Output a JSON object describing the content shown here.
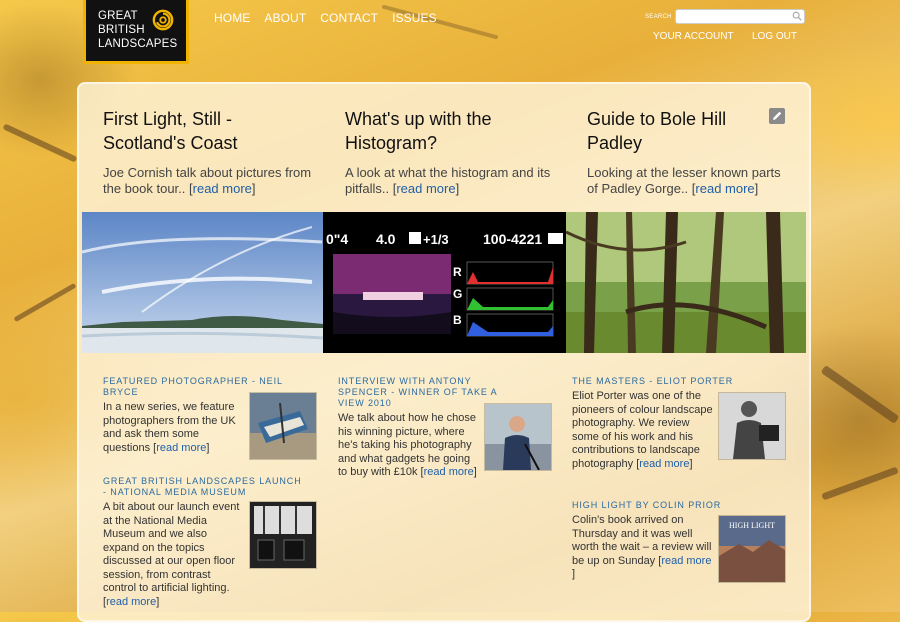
{
  "header": {
    "logo_lines": [
      "GREAT",
      "BRITISH",
      "LANDSCAPES"
    ],
    "nav": [
      "HOME",
      "ABOUT",
      "CONTACT",
      "ISSUES"
    ],
    "search_label": "SEARCH",
    "search_placeholder": "",
    "your_account": "YOUR ACCOUNT",
    "log_out": "LOG OUT"
  },
  "features": [
    {
      "title": "First Light, Still - Scotland's Coast",
      "summary": "Joe Cornish talk about pictures from the book tour..",
      "read_more": "read more"
    },
    {
      "title": "What's up with the Histogram?",
      "summary": "A look at what the histogram and its pitfalls..",
      "read_more": "read more"
    },
    {
      "title": "Guide to Bole Hill Padley",
      "summary": "Looking at the lesser known parts of Padley Gorge..",
      "read_more": "read more"
    }
  ],
  "histogram_readout": {
    "shutter": "0\"4",
    "aperture": "4.0",
    "exposure_comp": "+1/3",
    "frame": "100-4221",
    "channels": [
      "R",
      "G",
      "B"
    ]
  },
  "articles": [
    {
      "title": "FEATURED PHOTOGRAPHER - NEIL BRYCE",
      "body": "In a new series, we feature photographers from the UK and ask them some questions",
      "read_more": "read more"
    },
    {
      "title": "GREAT BRITISH LANDSCAPES LAUNCH - NATIONAL MEDIA MUSEUM",
      "body": "A bit about our launch event at the National Media Museum and we also expand on the topics discussed at our open floor session, from contrast control to artificial lighting.",
      "read_more": "read more"
    },
    {
      "title": "INTERVIEW WITH ANTONY SPENCER - WINNER OF TAKE A VIEW 2010",
      "body": "We talk about how he chose his winning picture, where he's taking his photography and what gadgets he going to buy with £10k",
      "read_more": "read more"
    },
    {
      "title": "THE MASTERS - ELIOT PORTER",
      "body": "Eliot Porter was one of the pioneers of colour landscape photography. We review some of his work and his contributions to landscape photography",
      "read_more": "read more"
    },
    {
      "title": "HIGH LIGHT BY COLIN PRIOR",
      "body": "Colin's book arrived on Thursday and it was well worth the wait – a review will be up on Sunday",
      "read_more": "read more",
      "trail": " ]",
      "book_cover_title": "HIGH LIGHT"
    }
  ],
  "colors": {
    "accent_gold": "#f0b400",
    "link_blue": "#1f5fa8",
    "heading_blue": "#2a6aa0"
  }
}
